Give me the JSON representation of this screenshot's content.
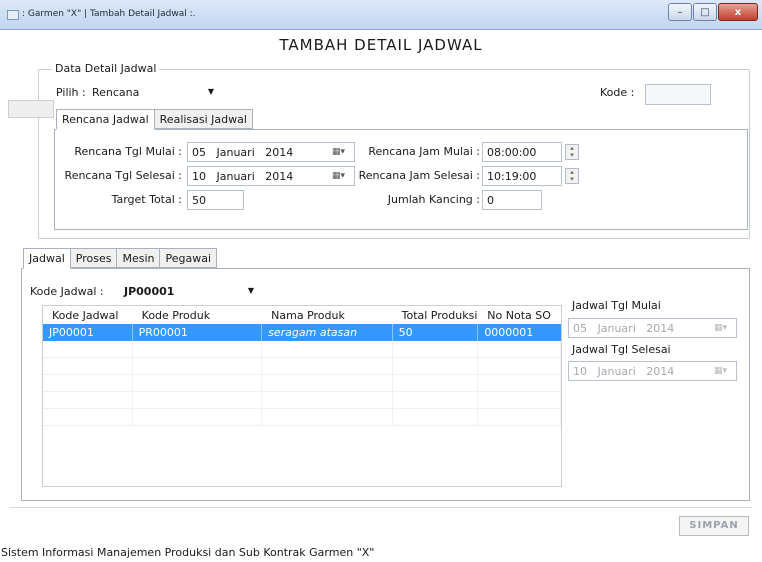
{
  "window": {
    "title": ": Garmen \"X\" | Tambah Detail Jadwal :.",
    "btn_min": "–",
    "btn_max": "□",
    "btn_close": "x"
  },
  "heading": "TAMBAH DETAIL JADWAL",
  "detail_group": {
    "title": "Data Detail Jadwal",
    "pilih_label": "Pilih :",
    "pilih_value": "Rencana",
    "kode_label": "Kode :",
    "kode_value": ""
  },
  "top_tabs": [
    "Rencana Jadwal",
    "Realisasi Jadwal"
  ],
  "rencana": {
    "tgl_mulai_label": "Rencana Tgl Mulai :",
    "tgl_mulai": {
      "day": "05",
      "month": "Januari",
      "year": "2014"
    },
    "tgl_selesai_label": "Rencana Tgl Selesai :",
    "tgl_selesai": {
      "day": "10",
      "month": "Januari",
      "year": "2014"
    },
    "target_label": "Target Total :",
    "target_value": "50",
    "jam_mulai_label": "Rencana Jam Mulai :",
    "jam_mulai": "08:00:00",
    "jam_selesai_label": "Rencana Jam Selesai :",
    "jam_selesai": "10:19:00",
    "kancing_label": "Jumlah Kancing :",
    "kancing_value": "0"
  },
  "bottom_tabs": [
    "Jadwal",
    "Proses",
    "Mesin",
    "Pegawai"
  ],
  "jadwal": {
    "kode_label": "Kode Jadwal :",
    "kode_value": "JP00001",
    "columns": [
      "Kode Jadwal",
      "Kode Produk",
      "Nama Produk",
      "Total Produksi",
      "No Nota SO"
    ],
    "rows": [
      [
        "JP00001",
        "PR00001",
        "seragam atasan",
        "50",
        "0000001"
      ]
    ],
    "tgl_mulai_label": "Jadwal Tgl Mulai",
    "tgl_mulai": {
      "day": "05",
      "month": "Januari",
      "year": "2014"
    },
    "tgl_selesai_label": "Jadwal Tgl Selesai",
    "tgl_selesai": {
      "day": "10",
      "month": "Januari",
      "year": "2014"
    }
  },
  "simpan_label": "SIMPAN",
  "status": "Sistem Informasi Manajemen Produksi dan Sub Kontrak Garmen \"X\""
}
